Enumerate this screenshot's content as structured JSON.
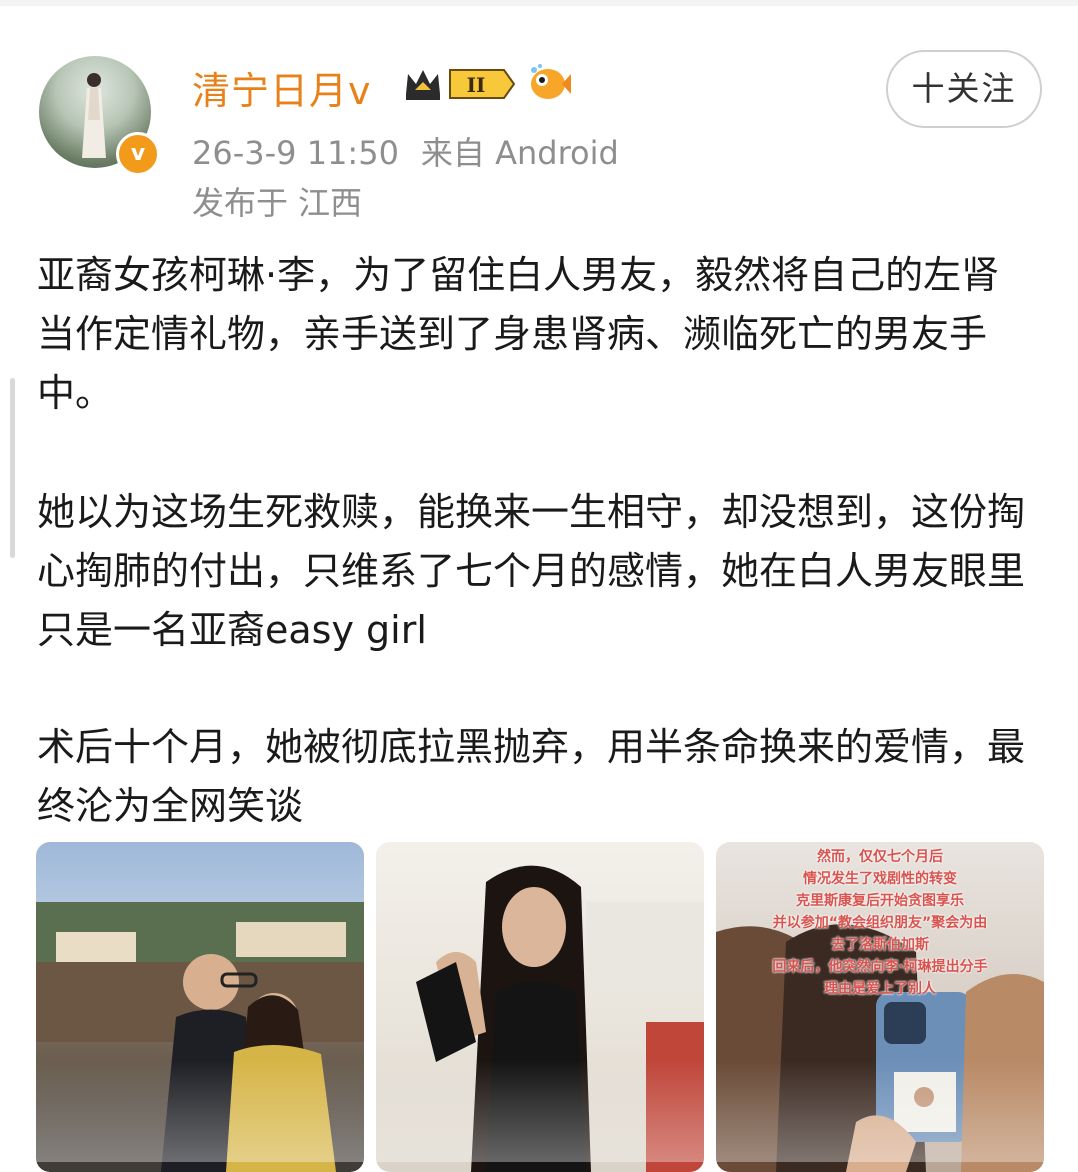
{
  "post": {
    "username": "清宁日月v",
    "level_badge": "II",
    "verified_mark": "v",
    "timestamp": "26-3-9 11:50",
    "source": "来自 Android",
    "location": "发布于 江西",
    "follow_label": "十关注",
    "paragraphs": [
      "亚裔女孩柯琳·李，为了留住白人男友，毅然将自己的左肾当作定情礼物，亲手送到了身患肾病、濒临死亡的男友手中。",
      "她以为这场生死救赎，能换来一生相守，却没想到，这份掏心掏肺的付出，只维系了七个月的感情，她在白人男友眼里只是一名亚裔easy girl",
      "术后十个月，她被彻底拉黑抛弃，用半条命换来的爱情，最终沦为全网笑谈"
    ]
  },
  "images": [
    {
      "kind": "photo",
      "overlay_lines": [],
      "watermark": ""
    },
    {
      "kind": "photo",
      "overlay_lines": [],
      "watermark": ""
    },
    {
      "kind": "photo",
      "overlay_lines": [
        "然而，仅仅七个月后",
        "情况发生了戏剧性的转变",
        "克里斯康复后开始贪图享乐",
        "并以参加“教会组织朋友”聚会为由",
        "去了洛斯伯加斯",
        "回来后，他突然向李·柯琳提出分手",
        "理由是爱上了别人"
      ],
      "watermark": ""
    }
  ],
  "colors": {
    "username": "#e8811a",
    "meta": "#8e8e8e",
    "body_text": "#1a1a1a",
    "verified_badge": "#f29a1a",
    "overlay_text": "#d9534f"
  },
  "icons": [
    "crown-icon",
    "level-badge-icon",
    "fish-icon",
    "verified-icon"
  ]
}
